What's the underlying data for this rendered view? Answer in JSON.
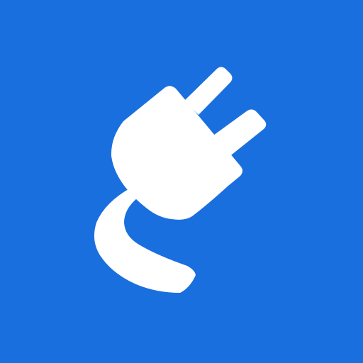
{
  "app_icon": {
    "icon": "electric-plug-icon",
    "background_color": "#1a6fdf",
    "foreground_color": "#ffffff"
  }
}
